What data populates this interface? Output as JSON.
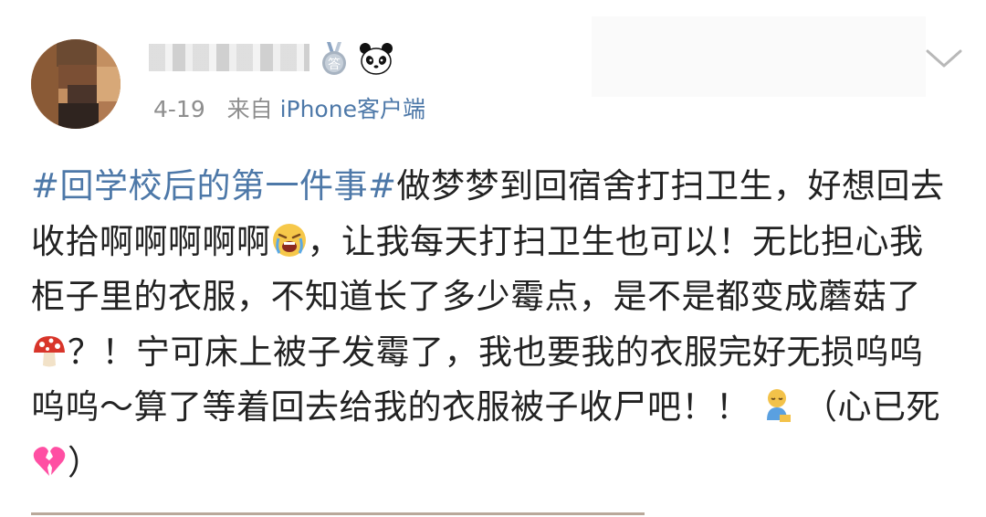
{
  "post": {
    "date": "4-19",
    "source_prefix": "来自",
    "source": "iPhone客户端",
    "hashtag": "#回学校后的第一件事#",
    "text_part1": "做梦梦到回宿舍打扫卫生，好想回去收拾啊啊啊啊啊",
    "text_part2": "，让我每天打扫卫生也可以！无比担心我柜子里的衣服，不知道长了多少霉点，是不是都变成蘑菇了",
    "text_part3": "？！宁可床上被子发霉了，我也要我的衣服完好无损呜呜呜呜～算了等着回去给我的衣服被子收尸吧！！",
    "text_part4": "（心已死",
    "text_part5": "）"
  },
  "icons": {
    "badge": "medal-icon",
    "panda": "panda-icon",
    "menu": "chevron-down-icon",
    "emoji_crying": "crying-face-emoji",
    "emoji_mushroom": "mushroom-emoji",
    "emoji_sleepy": "sleepy-person-emoji",
    "emoji_heart": "broken-heart-emoji"
  },
  "colors": {
    "link": "#4d78a8",
    "text": "#222222",
    "meta": "#8e8e8e"
  }
}
